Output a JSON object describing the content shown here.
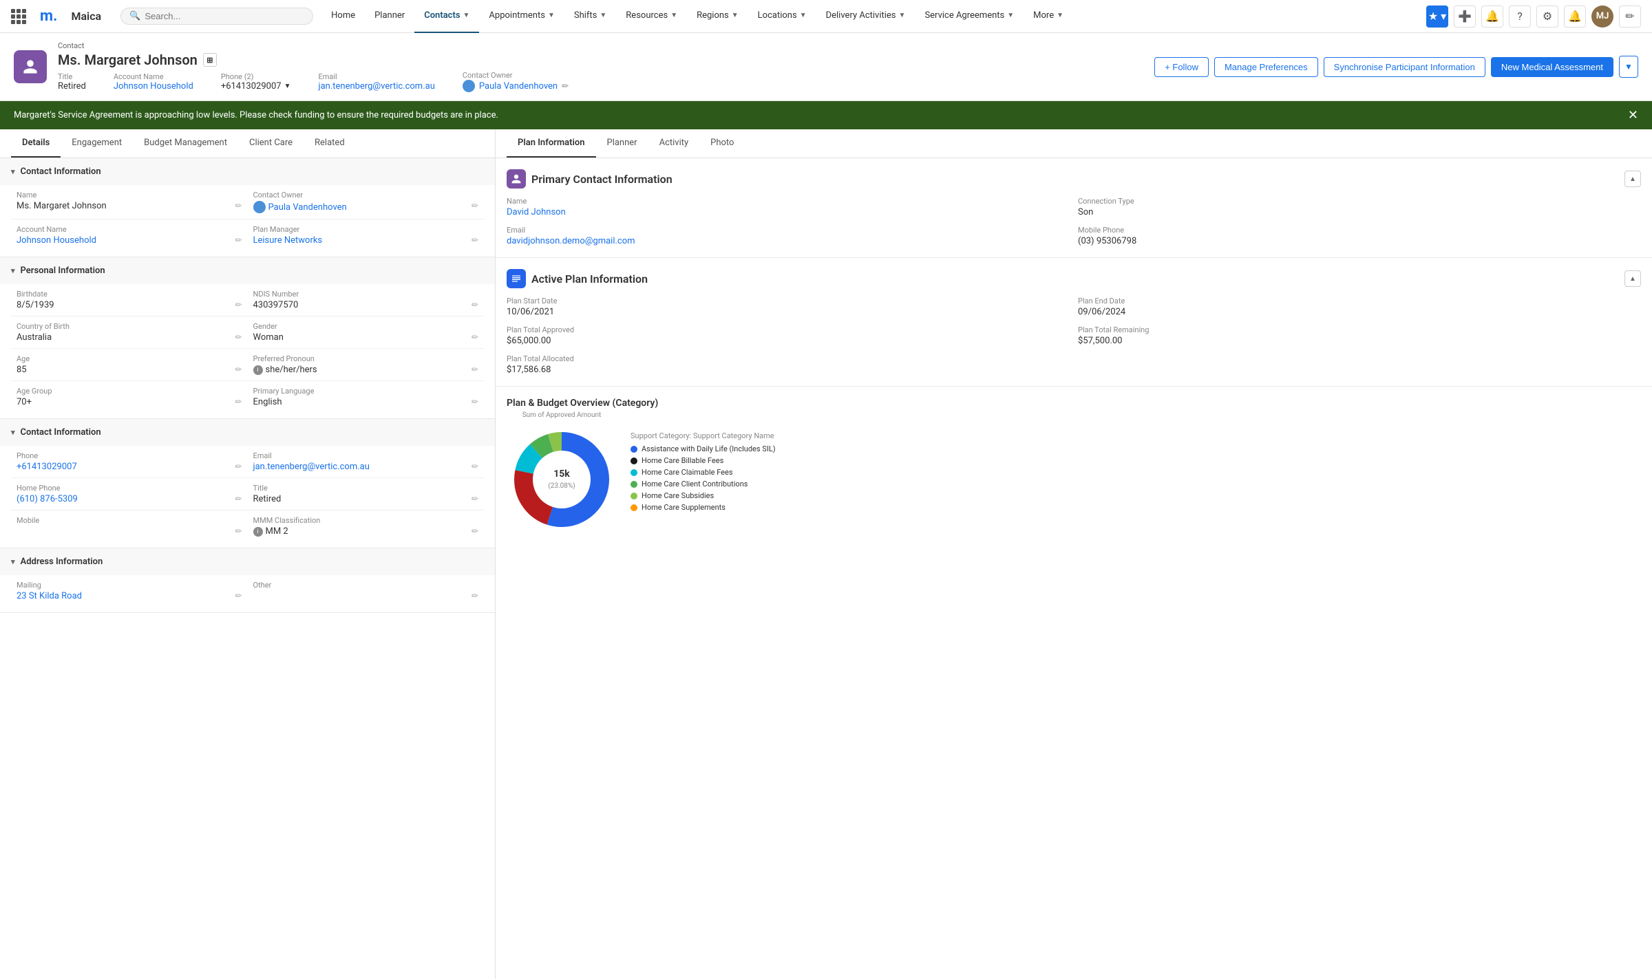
{
  "topbar": {
    "logo": "m.",
    "appname": "Maica",
    "search_placeholder": "Search...",
    "nav": [
      {
        "label": "Home",
        "active": false,
        "has_arrow": false
      },
      {
        "label": "Planner",
        "active": false,
        "has_arrow": false
      },
      {
        "label": "Contacts",
        "active": true,
        "has_arrow": true
      },
      {
        "label": "Appointments",
        "active": false,
        "has_arrow": true
      },
      {
        "label": "Shifts",
        "active": false,
        "has_arrow": true
      },
      {
        "label": "Resources",
        "active": false,
        "has_arrow": true
      },
      {
        "label": "Regions",
        "active": false,
        "has_arrow": true
      },
      {
        "label": "Locations",
        "active": false,
        "has_arrow": true
      },
      {
        "label": "Delivery Activities",
        "active": false,
        "has_arrow": true
      },
      {
        "label": "Service Agreements",
        "active": false,
        "has_arrow": true
      },
      {
        "label": "More",
        "active": false,
        "has_arrow": true
      }
    ]
  },
  "contact_header": {
    "label": "Contact",
    "name": "Ms. Margaret Johnson",
    "title_label": "Title",
    "title_value": "Retired",
    "account_name_label": "Account Name",
    "account_name_value": "Johnson Household",
    "phone_label": "Phone (2)",
    "phone_value": "+61413029007",
    "email_label": "Email",
    "email_value": "jan.tenenberg@vertic.com.au",
    "owner_label": "Contact Owner",
    "owner_value": "Paula Vandenhoven",
    "actions": {
      "follow": "+ Follow",
      "manage": "Manage Preferences",
      "sync": "Synchronise Participant Information",
      "medical": "New Medical Assessment"
    }
  },
  "alert": {
    "message": "Margaret's Service Agreement is approaching low levels. Please check funding to ensure the required budgets are in place."
  },
  "left_tabs": [
    {
      "label": "Details",
      "active": true
    },
    {
      "label": "Engagement",
      "active": false
    },
    {
      "label": "Budget Management",
      "active": false
    },
    {
      "label": "Client Care",
      "active": false
    },
    {
      "label": "Related",
      "active": false
    }
  ],
  "sections": {
    "contact_info": {
      "title": "Contact Information",
      "fields_left": [
        {
          "label": "Name",
          "value": "Ms. Margaret Johnson",
          "link": false
        },
        {
          "label": "Account Name",
          "value": "Johnson Household",
          "link": true
        }
      ],
      "fields_right": [
        {
          "label": "Contact Owner",
          "value": "Paula Vandenhoven",
          "link": true,
          "has_avatar": true
        },
        {
          "label": "Plan Manager",
          "value": "Leisure Networks",
          "link": true
        }
      ]
    },
    "personal_info": {
      "title": "Personal Information",
      "fields_left": [
        {
          "label": "Birthdate",
          "value": "8/5/1939"
        },
        {
          "label": "Country of Birth",
          "value": "Australia"
        },
        {
          "label": "Age",
          "value": "85"
        },
        {
          "label": "Age Group",
          "value": "70+"
        }
      ],
      "fields_right": [
        {
          "label": "NDIS Number",
          "value": "430397570"
        },
        {
          "label": "Gender",
          "value": "Woman"
        },
        {
          "label": "Preferred Pronoun",
          "value": "she/her/hers",
          "has_info": true
        },
        {
          "label": "Primary Language",
          "value": "English"
        }
      ]
    },
    "contact_info2": {
      "title": "Contact Information",
      "fields_left": [
        {
          "label": "Phone",
          "value": "+61413029007",
          "link": true
        },
        {
          "label": "Home Phone",
          "value": "(610) 876-5309",
          "link": true
        },
        {
          "label": "Mobile",
          "value": ""
        }
      ],
      "fields_right": [
        {
          "label": "Email",
          "value": "jan.tenenberg@vertic.com.au",
          "link": true
        },
        {
          "label": "Title",
          "value": "Retired"
        },
        {
          "label": "MMM Classification",
          "value": "MM 2",
          "has_info": true
        }
      ]
    },
    "address_info": {
      "title": "Address Information",
      "fields_left": [
        {
          "label": "Mailing",
          "value": "23 St Kilda Road",
          "link": true
        }
      ],
      "fields_right": [
        {
          "label": "Other",
          "value": ""
        }
      ]
    }
  },
  "right_tabs": [
    {
      "label": "Plan Information",
      "active": true
    },
    {
      "label": "Planner",
      "active": false
    },
    {
      "label": "Activity",
      "active": false
    },
    {
      "label": "Photo",
      "active": false
    }
  ],
  "primary_contact": {
    "title": "Primary Contact Information",
    "name_label": "Name",
    "name_value": "David Johnson",
    "connection_label": "Connection Type",
    "connection_value": "Son",
    "email_label": "Email",
    "email_value": "davidjohnson.demo@gmail.com",
    "mobile_label": "Mobile Phone",
    "mobile_value": "(03) 95306798"
  },
  "active_plan": {
    "title": "Active Plan Information",
    "start_label": "Plan Start Date",
    "start_value": "10/06/2021",
    "end_label": "Plan End Date",
    "end_value": "09/06/2024",
    "approved_label": "Plan Total Approved",
    "approved_value": "$65,000.00",
    "remaining_label": "Plan Total Remaining",
    "remaining_value": "$57,500.00",
    "allocated_label": "Plan Total Allocated",
    "allocated_value": "$17,586.68"
  },
  "chart": {
    "title": "Plan & Budget Overview (Category)",
    "subtitle": "Sum of Approved Amount",
    "legend_title": "Support Category: Support Category Name",
    "center_label": "15k",
    "center_sub": "(23.08%)",
    "legend_items": [
      {
        "label": "Assistance with Daily Life (Includes SIL)",
        "color": "#2563eb"
      },
      {
        "label": "Home Care Billable Fees",
        "color": "#1a1a1a"
      },
      {
        "label": "Home Care Claimable Fees",
        "color": "#00bcd4"
      },
      {
        "label": "Home Care Client Contributions",
        "color": "#4caf50"
      },
      {
        "label": "Home Care Subsidies",
        "color": "#8bc34a"
      },
      {
        "label": "Home Care Supplements",
        "color": "#ff9800"
      }
    ],
    "segments": [
      {
        "color": "#2563eb",
        "percentage": 55,
        "start": 0
      },
      {
        "color": "#b91c1c",
        "percentage": 23,
        "start": 55
      },
      {
        "color": "#00bcd4",
        "percentage": 10,
        "start": 78
      },
      {
        "color": "#4caf50",
        "percentage": 7,
        "start": 88
      },
      {
        "color": "#8bc34a",
        "percentage": 5,
        "start": 95
      }
    ]
  }
}
